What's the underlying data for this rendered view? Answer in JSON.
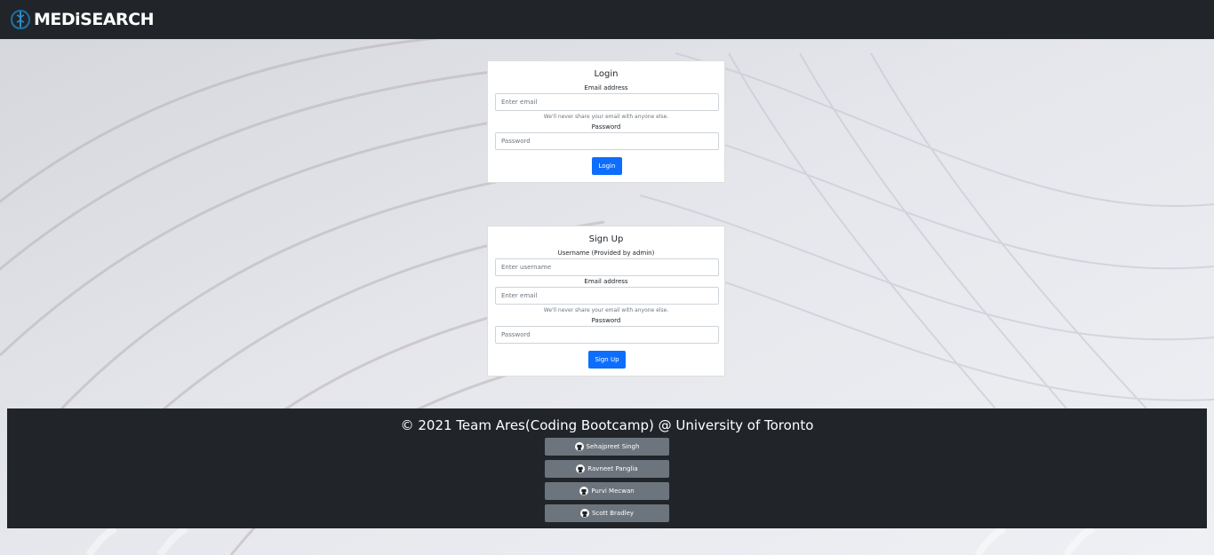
{
  "app": {
    "brand_text": "MEDiSEARCH",
    "brand_icon": "caduceus-hands-logo"
  },
  "login": {
    "title": "Login",
    "email_label": "Email address",
    "email_placeholder": "Enter email",
    "email_help": "We'll never share your email with anyone else.",
    "password_label": "Password",
    "password_placeholder": "Password",
    "submit_label": "Login"
  },
  "signup": {
    "title": "Sign Up",
    "username_label": "Username (Provided by admin)",
    "username_placeholder": "Enter username",
    "email_label": "Email address",
    "email_placeholder": "Enter email",
    "email_help": "We'll never share your email with anyone else.",
    "password_label": "Password",
    "password_placeholder": "Password",
    "submit_label": "Sign Up"
  },
  "footer": {
    "copyright": "© 2021 Team Ares(Coding Bootcamp) @ University of Toronto",
    "contributors": [
      {
        "name": "Sehajpreet Singh",
        "icon": "github-icon"
      },
      {
        "name": "Ravneet Panglia",
        "icon": "github-icon"
      },
      {
        "name": "Purvi Mecwan",
        "icon": "github-icon"
      },
      {
        "name": "Scott Bradley",
        "icon": "github-icon"
      }
    ]
  },
  "colors": {
    "navbar": "#212529",
    "primary": "#0d6efd",
    "secondary": "#6c757d",
    "brand_icon": "#1e6fa5"
  }
}
